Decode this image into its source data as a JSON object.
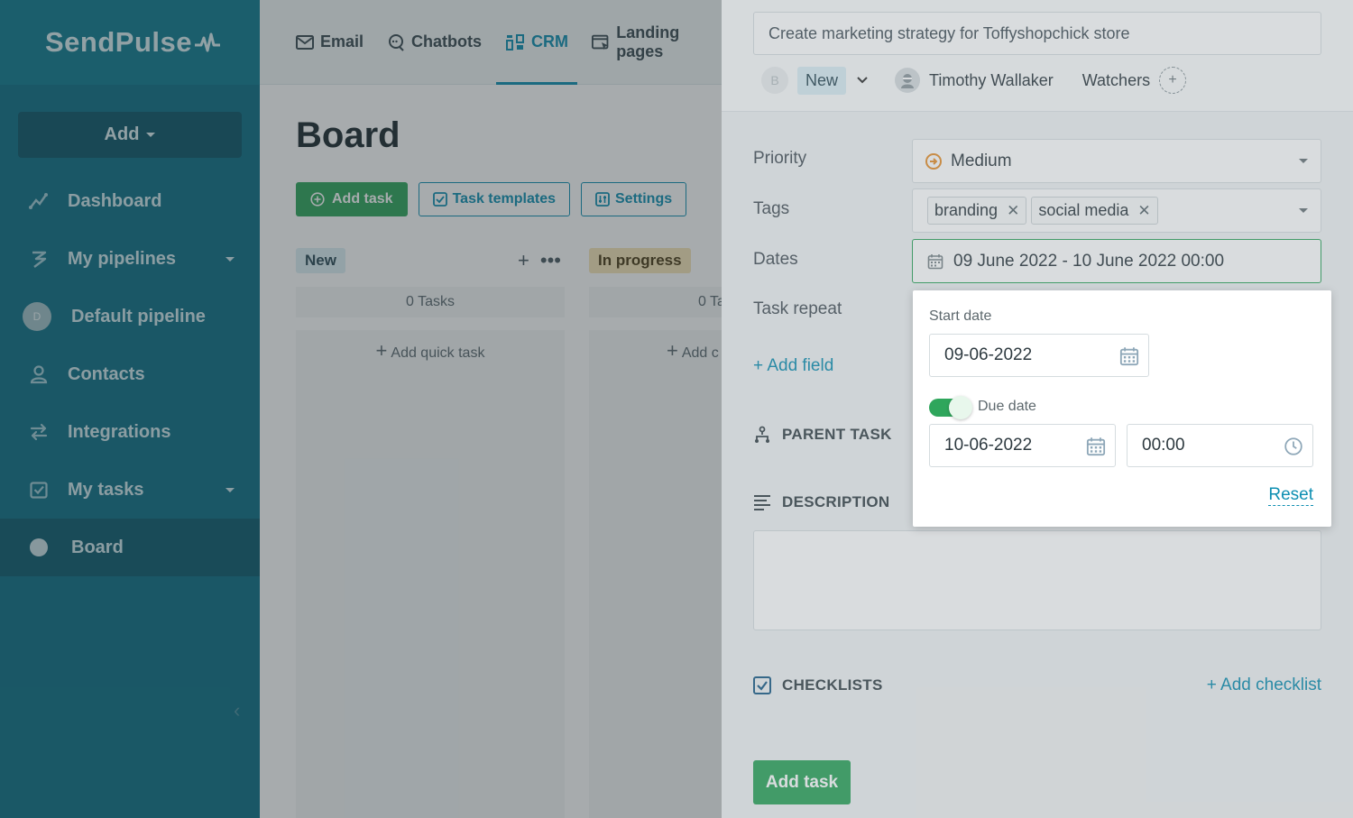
{
  "brand": {
    "name": "SendPulse"
  },
  "sidebar": {
    "add_label": "Add",
    "items": [
      {
        "label": "Dashboard",
        "icon": "chart-line-icon"
      },
      {
        "label": "My pipelines",
        "icon": "pipeline-icon"
      },
      {
        "label": "Default pipeline",
        "avatar": "D"
      },
      {
        "label": "Contacts",
        "icon": "contacts-icon"
      },
      {
        "label": "Integrations",
        "icon": "integrations-icon"
      },
      {
        "label": "My tasks",
        "icon": "checkbox-icon"
      },
      {
        "label": "Board",
        "icon": "dot-icon"
      }
    ]
  },
  "topnav": {
    "tabs": [
      {
        "label": "Email",
        "icon": "envelope-icon"
      },
      {
        "label": "Chatbots",
        "icon": "chat-icon"
      },
      {
        "label": "CRM",
        "icon": "crm-icon"
      },
      {
        "label": "Landing pages",
        "icon": "landing-icon"
      }
    ]
  },
  "board": {
    "title": "Board",
    "add_task": "Add task",
    "task_templates": "Task templates",
    "settings": "Settings",
    "columns": [
      {
        "name": "New",
        "count": "0 Tasks",
        "quick_add": "Add quick task"
      },
      {
        "name": "In progress",
        "count": "0 Ta",
        "quick_add": "Add c"
      }
    ]
  },
  "panel": {
    "task_title": "Create marketing strategy for Toffyshopchick store",
    "assignee_initial": "B",
    "status": "New",
    "user_name": "Timothy Wallaker",
    "watchers_label": "Watchers",
    "fields": {
      "priority_label": "Priority",
      "priority_value": "Medium",
      "tags_label": "Tags",
      "tags": [
        "branding",
        "social media"
      ],
      "dates_label": "Dates",
      "dates_value": "09 June 2022 - 10 June 2022 00:00",
      "repeat_label": "Task repeat",
      "add_field": "+ Add field"
    },
    "parent_task": "PARENT TASK",
    "description": "DESCRIPTION",
    "checklists": "CHECKLISTS",
    "add_checklist": "+ Add checklist",
    "add_task_button": "Add task"
  },
  "date_popup": {
    "start_label": "Start date",
    "start_value": "09-06-2022",
    "due_label": "Due date",
    "due_enabled": true,
    "due_value": "10-06-2022",
    "time_value": "00:00",
    "reset": "Reset"
  },
  "colors": {
    "sidebar_bg": "#0d6f85",
    "accent": "#0e8fb2",
    "green": "#2fa65c",
    "priority_orange": "#e8912d"
  }
}
